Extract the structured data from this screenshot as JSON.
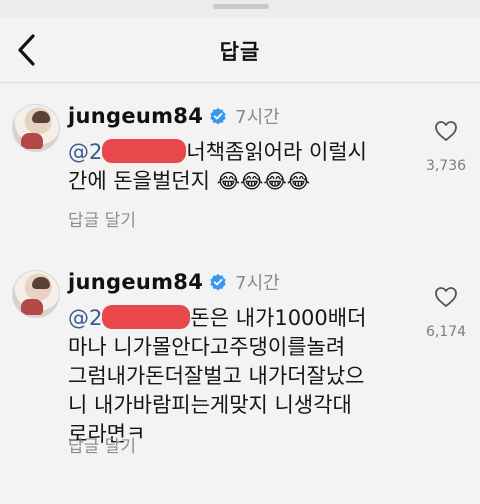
{
  "header": {
    "title": "답글"
  },
  "comments": [
    {
      "username": "jungeum84",
      "time": "7시간",
      "mention_prefix": "@2",
      "text_line1": "너책좀읽어라 이럴시",
      "text_line2": "간에 돈을벌던지",
      "emojis": "😂😂😂😂",
      "reply_label": "답글 달기",
      "like_count": "3,736"
    },
    {
      "username": "jungeum84",
      "time": "7시간",
      "mention_prefix": "@2",
      "text_line1": "돈은 내가1000배더",
      "text_line2": "마나 니가몰안다고주댕이를놀려",
      "text_line3": "그럼내가돈더잘벌고 내가더잘났으",
      "text_line4": "니 내가바람피는게맞지 니생각대",
      "text_line5": "로라면ㅋ",
      "reply_label": "답글 달기",
      "like_count": "6,174"
    }
  ],
  "colors": {
    "redaction": "#e8484b",
    "verified": "#3897f0",
    "mention": "#3a5d8f"
  }
}
